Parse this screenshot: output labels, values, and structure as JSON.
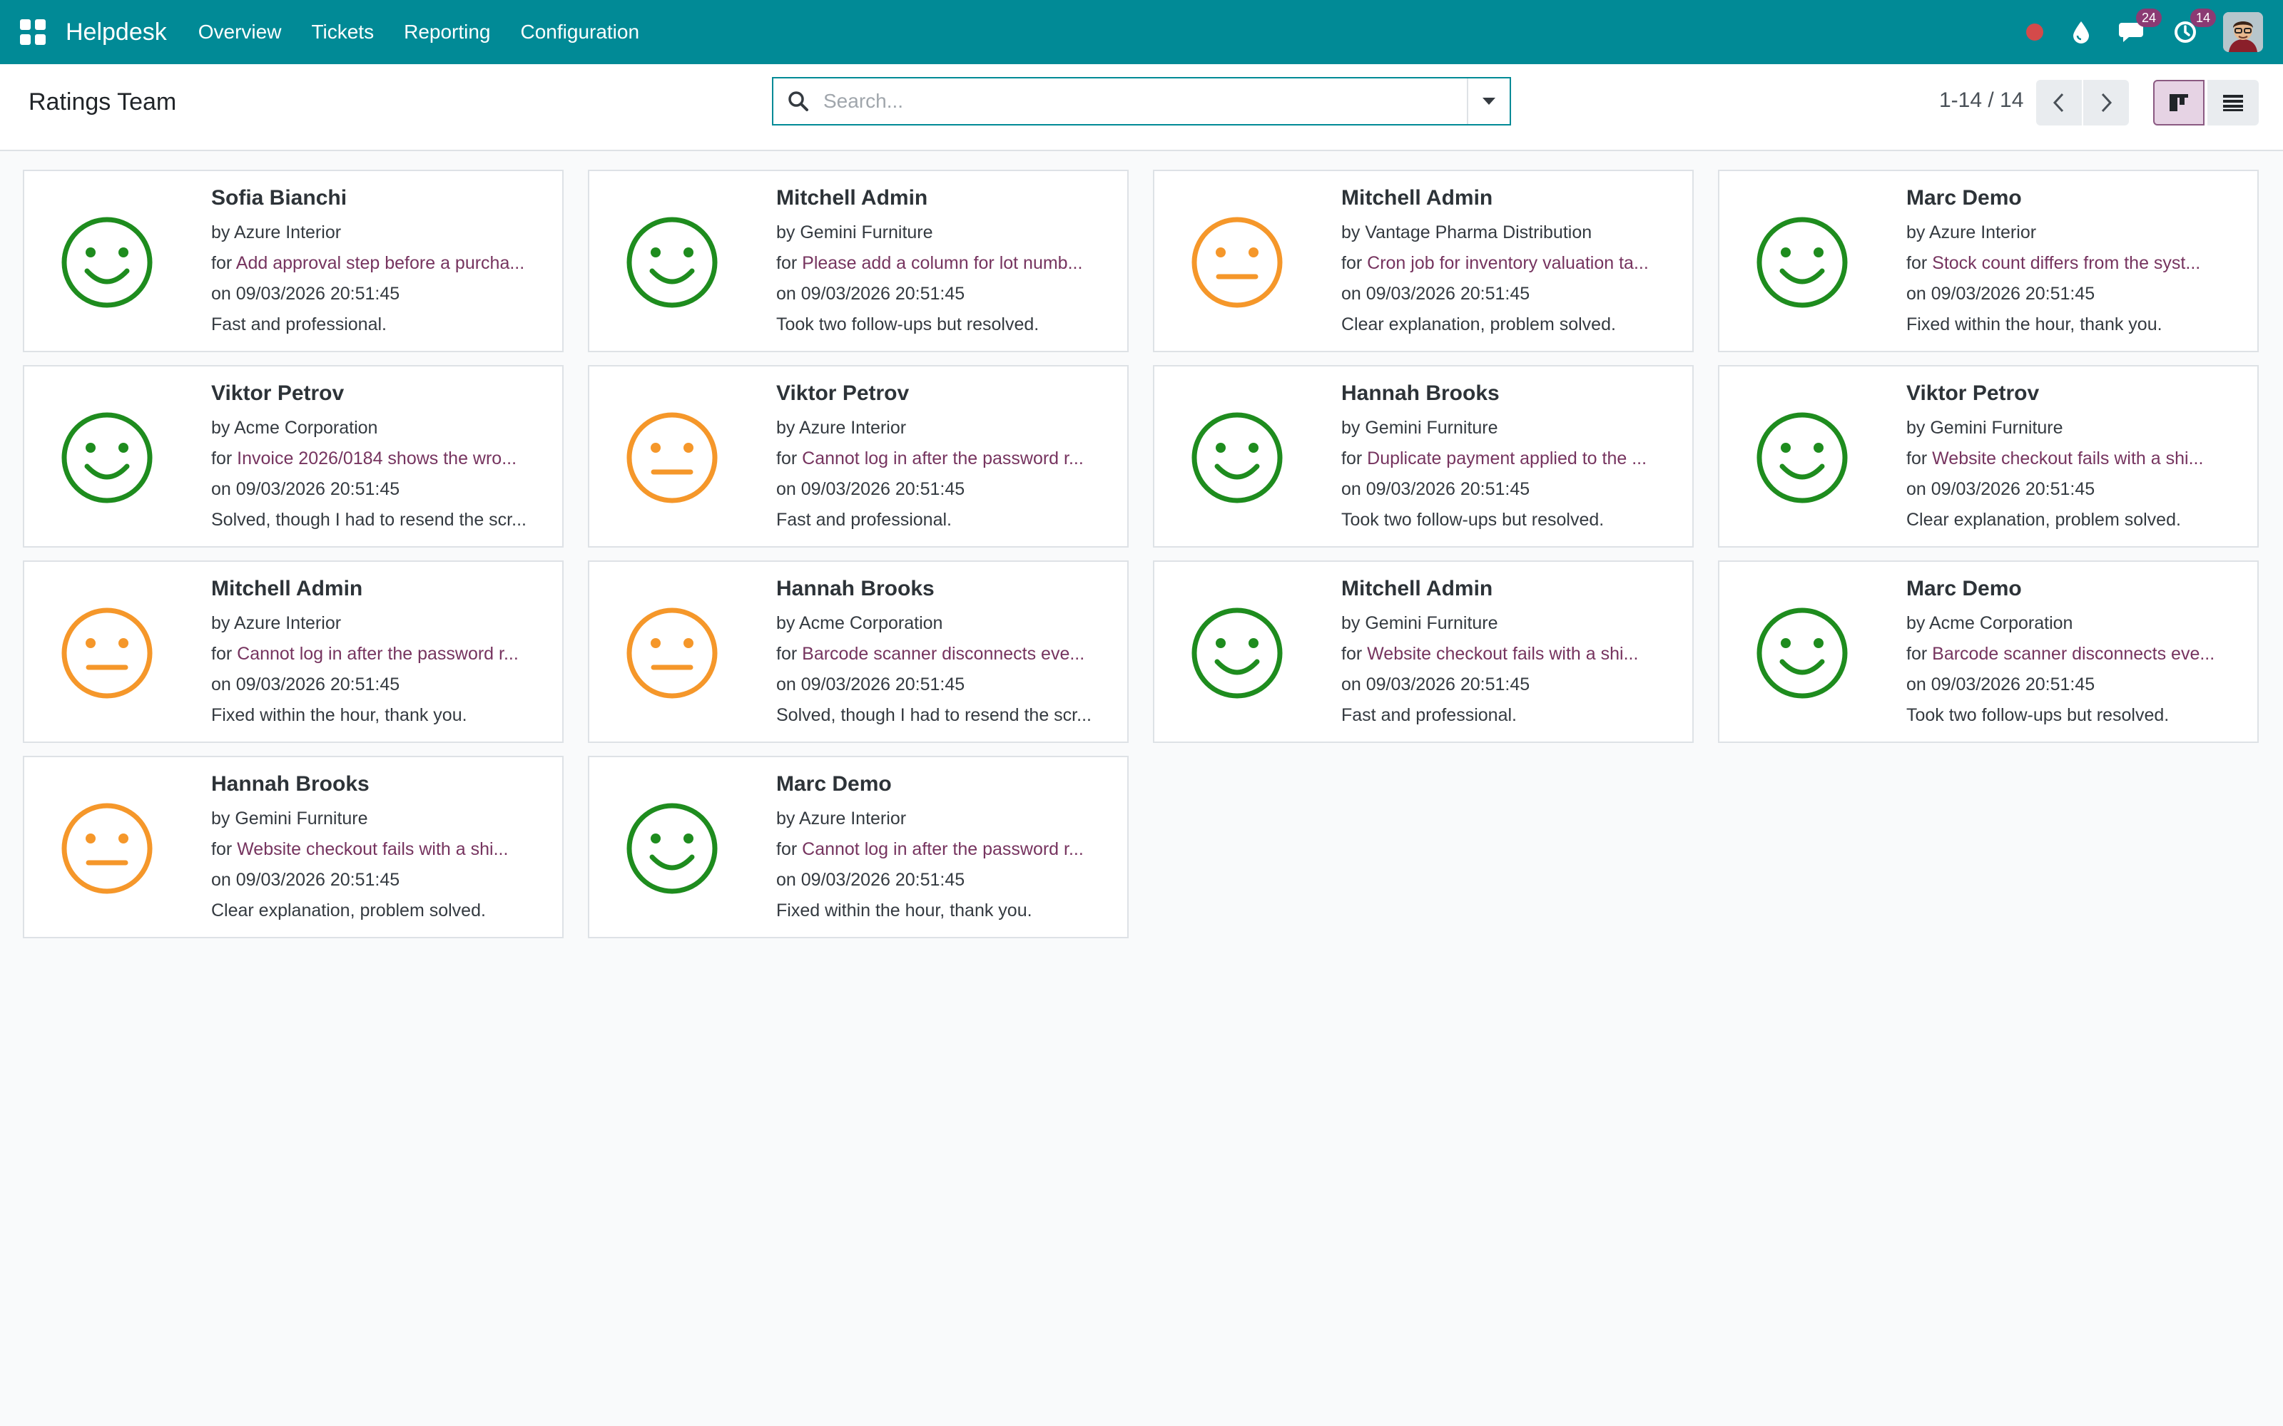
{
  "navbar": {
    "brand": "Helpdesk",
    "menu": [
      "Overview",
      "Tickets",
      "Reporting",
      "Configuration"
    ],
    "messages_count": "24",
    "activities_count": "14",
    "color": "#018a96"
  },
  "control_panel": {
    "title": "Ratings Team",
    "search_placeholder": "Search...",
    "pager": "1-14 / 14"
  },
  "colors": {
    "happy": "#1e8c1e",
    "neutral": "#f5972a",
    "link": "#76345f"
  },
  "ratings": [
    {
      "name": "Sofia Bianchi",
      "by_prefix": "by",
      "partner": "Azure Interior",
      "for_prefix": "for",
      "ticket": "Add approval step before a purcha...",
      "date": "on 09/03/2026 20:51:45",
      "feedback": "Fast and professional.",
      "face": "happy"
    },
    {
      "name": "Mitchell Admin",
      "by_prefix": "by",
      "partner": "Gemini Furniture",
      "for_prefix": "for",
      "ticket": "Please add a column for lot numb...",
      "date": "on 09/03/2026 20:51:45",
      "feedback": "Took two follow-ups but resolved.",
      "face": "happy"
    },
    {
      "name": "Mitchell Admin",
      "by_prefix": "by",
      "partner": "Vantage Pharma Distribution",
      "for_prefix": "for",
      "ticket": "Cron job for inventory valuation ta...",
      "date": "on 09/03/2026 20:51:45",
      "feedback": "Clear explanation, problem solved.",
      "face": "neutral"
    },
    {
      "name": "Marc Demo",
      "by_prefix": "by",
      "partner": "Azure Interior",
      "for_prefix": "for",
      "ticket": "Stock count differs from the syst...",
      "date": "on 09/03/2026 20:51:45",
      "feedback": "Fixed within the hour, thank you.",
      "face": "happy"
    },
    {
      "name": "Viktor Petrov",
      "by_prefix": "by",
      "partner": "Acme Corporation",
      "for_prefix": "for",
      "ticket": "Invoice 2026/0184 shows the wro...",
      "date": "on 09/03/2026 20:51:45",
      "feedback": "Solved, though I had to resend the scr...",
      "face": "happy"
    },
    {
      "name": "Viktor Petrov",
      "by_prefix": "by",
      "partner": "Azure Interior",
      "for_prefix": "for",
      "ticket": "Cannot log in after the password r...",
      "date": "on 09/03/2026 20:51:45",
      "feedback": "Fast and professional.",
      "face": "neutral"
    },
    {
      "name": "Hannah Brooks",
      "by_prefix": "by",
      "partner": "Gemini Furniture",
      "for_prefix": "for",
      "ticket": "Duplicate payment applied to the ...",
      "date": "on 09/03/2026 20:51:45",
      "feedback": "Took two follow-ups but resolved.",
      "face": "happy"
    },
    {
      "name": "Viktor Petrov",
      "by_prefix": "by",
      "partner": "Gemini Furniture",
      "for_prefix": "for",
      "ticket": "Website checkout fails with a shi...",
      "date": "on 09/03/2026 20:51:45",
      "feedback": "Clear explanation, problem solved.",
      "face": "happy"
    },
    {
      "name": "Mitchell Admin",
      "by_prefix": "by",
      "partner": "Azure Interior",
      "for_prefix": "for",
      "ticket": "Cannot log in after the password r...",
      "date": "on 09/03/2026 20:51:45",
      "feedback": "Fixed within the hour, thank you.",
      "face": "neutral"
    },
    {
      "name": "Hannah Brooks",
      "by_prefix": "by",
      "partner": "Acme Corporation",
      "for_prefix": "for",
      "ticket": "Barcode scanner disconnects eve...",
      "date": "on 09/03/2026 20:51:45",
      "feedback": "Solved, though I had to resend the scr...",
      "face": "neutral"
    },
    {
      "name": "Mitchell Admin",
      "by_prefix": "by",
      "partner": "Gemini Furniture",
      "for_prefix": "for",
      "ticket": "Website checkout fails with a shi...",
      "date": "on 09/03/2026 20:51:45",
      "feedback": "Fast and professional.",
      "face": "happy"
    },
    {
      "name": "Marc Demo",
      "by_prefix": "by",
      "partner": "Acme Corporation",
      "for_prefix": "for",
      "ticket": "Barcode scanner disconnects eve...",
      "date": "on 09/03/2026 20:51:45",
      "feedback": "Took two follow-ups but resolved.",
      "face": "happy"
    },
    {
      "name": "Hannah Brooks",
      "by_prefix": "by",
      "partner": "Gemini Furniture",
      "for_prefix": "for",
      "ticket": "Website checkout fails with a shi...",
      "date": "on 09/03/2026 20:51:45",
      "feedback": "Clear explanation, problem solved.",
      "face": "neutral"
    },
    {
      "name": "Marc Demo",
      "by_prefix": "by",
      "partner": "Azure Interior",
      "for_prefix": "for",
      "ticket": "Cannot log in after the password r...",
      "date": "on 09/03/2026 20:51:45",
      "feedback": "Fixed within the hour, thank you.",
      "face": "happy"
    }
  ]
}
